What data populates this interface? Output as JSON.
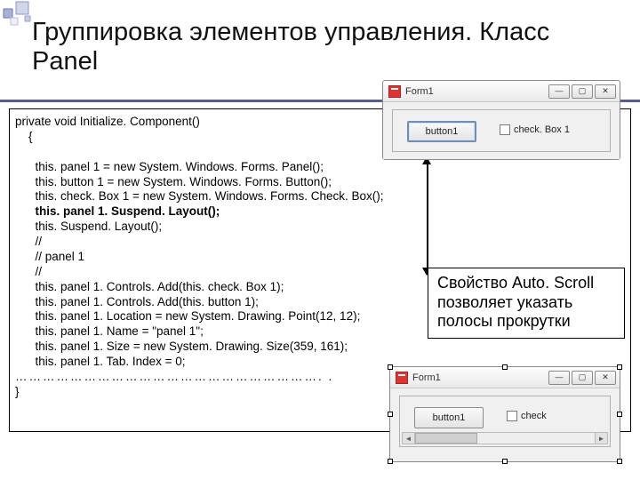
{
  "slide": {
    "title": "Группировка элементов управления. Класс Panel"
  },
  "code": {
    "l0": "private void Initialize. Component()",
    "l1": "    {",
    "l2": "      this. panel 1 = new System. Windows. Forms. Panel();",
    "l3": "      this. button 1 = new System. Windows. Forms. Button();",
    "l4": "      this. check. Box 1 = new System. Windows. Forms. Check. Box();",
    "l5": "      this. panel 1. Suspend. Layout();",
    "l6": "      this. Suspend. Layout();",
    "l7": "      //",
    "l8": "      // panel 1",
    "l9": "      //",
    "l10": "      this. panel 1. Controls. Add(this. check. Box 1);",
    "l11": "      this. panel 1. Controls. Add(this. button 1);",
    "l12": "      this. panel 1. Location = new System. Drawing. Point(12, 12);",
    "l13": "      this. panel 1. Name = \"panel 1\";",
    "l14": "      this. panel 1. Size = new System. Drawing. Size(359, 161);",
    "l15": "      this. panel 1. Tab. Index = 0;",
    "l16": "…………………………………………………………. .",
    "l17": "}"
  },
  "note": {
    "text": "Свойство Auto. Scroll позволяет указать полосы прокрутки"
  },
  "form_top": {
    "title": "Form1",
    "button_label": "button1",
    "checkbox_label": "check. Box 1",
    "win_min": "—",
    "win_max": "▢",
    "win_close": "✕"
  },
  "form_bot": {
    "title": "Form1",
    "button_label": "button1",
    "checkbox_label": "check",
    "win_min": "—",
    "win_max": "▢",
    "win_close": "✕",
    "scroll_left": "◄",
    "scroll_right": "►"
  }
}
